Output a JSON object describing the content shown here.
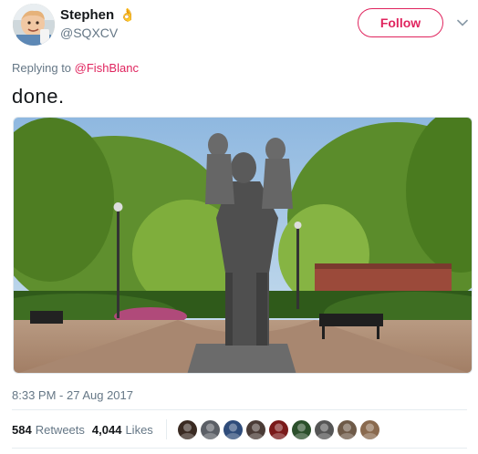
{
  "user": {
    "display_name": "Stephen",
    "name_emoji": "👌",
    "handle": "@SQXCV",
    "avatar_icon": "profile-photo"
  },
  "follow_label": "Follow",
  "reply": {
    "prefix": "Replying to",
    "to_handle": "@FishBlanc"
  },
  "tweet": {
    "text": "done."
  },
  "media": {
    "icon": "photo-statue-in-park"
  },
  "timestamp": "8:33 PM - 27 Aug 2017",
  "stats": {
    "retweets_count": "584",
    "retweets_label": "Retweets",
    "likes_count": "4,044",
    "likes_label": "Likes"
  },
  "liker_avatars": [
    {
      "color": "#3a2a22"
    },
    {
      "color": "#5b5f66"
    },
    {
      "color": "#2f4c7a"
    },
    {
      "color": "#4a3b36"
    },
    {
      "color": "#7a1a1a"
    },
    {
      "color": "#2b4f2b"
    },
    {
      "color": "#555555"
    },
    {
      "color": "#6e5a48"
    },
    {
      "color": "#8a6a4e"
    }
  ],
  "colors": {
    "accent": "#e0245e",
    "muted": "#657786",
    "text": "#14171a"
  }
}
